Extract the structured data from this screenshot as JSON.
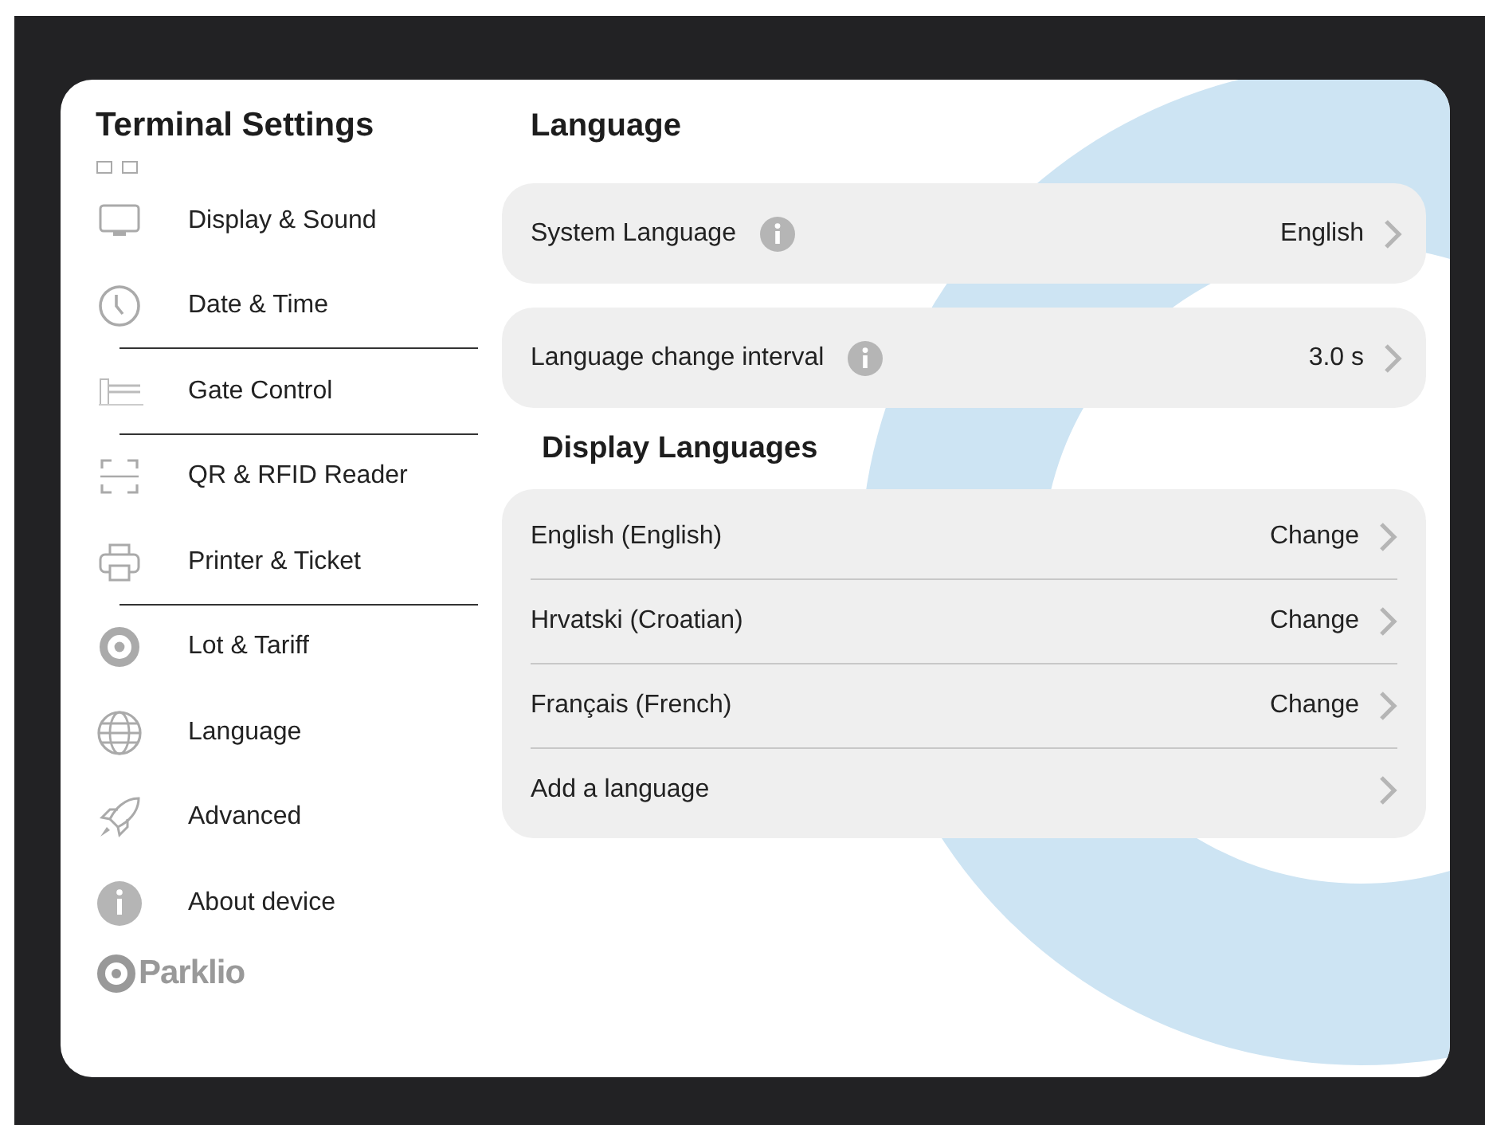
{
  "sidebar": {
    "title": "Terminal Settings",
    "items": [
      {
        "label": "Display & Sound",
        "separator": false
      },
      {
        "label": "Date & Time",
        "separator": true
      },
      {
        "label": "Gate Control",
        "separator": true
      },
      {
        "label": "QR & RFID Reader",
        "separator": false
      },
      {
        "label": "Printer & Ticket",
        "separator": true
      },
      {
        "label": "Lot & Tariff",
        "separator": false
      },
      {
        "label": "Language",
        "separator": false
      },
      {
        "label": "Advanced",
        "separator": false
      },
      {
        "label": "About device",
        "separator": false
      }
    ],
    "logo": "Parklio"
  },
  "main": {
    "title": "Language",
    "settings": [
      {
        "label": "System Language",
        "value": "English"
      },
      {
        "label": "Language change interval",
        "value": "3.0 s"
      }
    ],
    "section_title": "Display Languages",
    "languages": [
      {
        "label": "English (English)",
        "action": "Change"
      },
      {
        "label": "Hrvatski (Croatian)",
        "action": "Change"
      },
      {
        "label": "Français (French)",
        "action": "Change"
      },
      {
        "label": "Add a language"
      }
    ]
  }
}
